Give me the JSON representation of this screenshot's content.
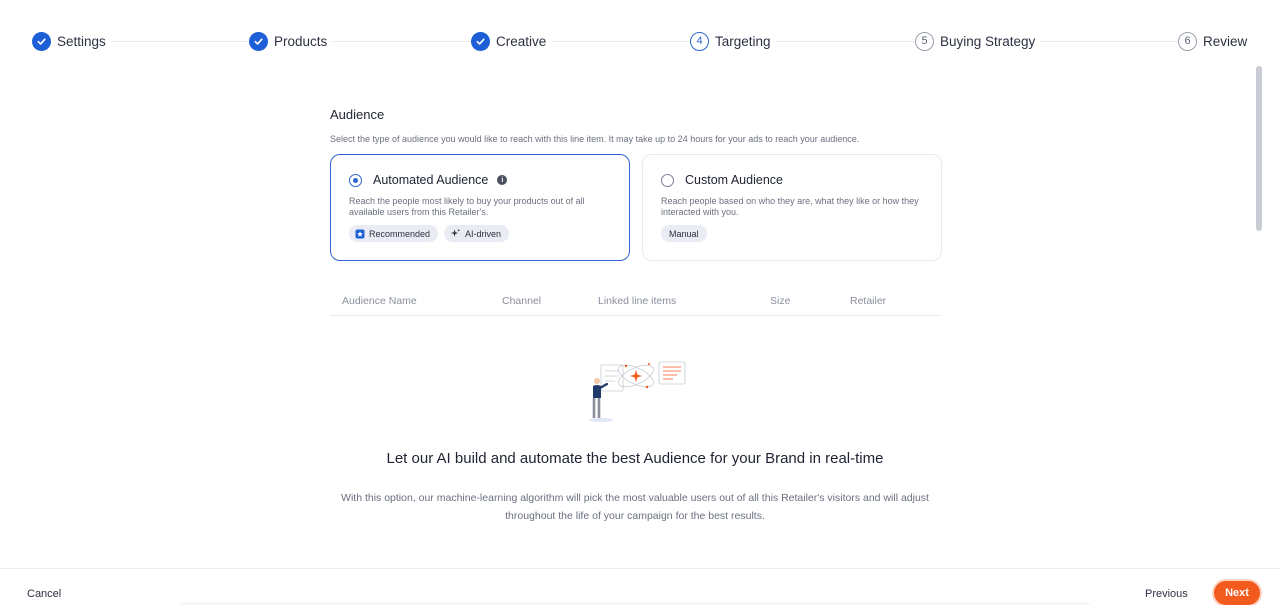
{
  "stepper": {
    "steps": [
      {
        "label": "Settings",
        "status": "done"
      },
      {
        "label": "Products",
        "status": "done"
      },
      {
        "label": "Creative",
        "status": "done"
      },
      {
        "label": "Targeting",
        "number": "4",
        "status": "current"
      },
      {
        "label": "Buying Strategy",
        "number": "5",
        "status": "todo"
      },
      {
        "label": "Review",
        "number": "6",
        "status": "todo"
      }
    ]
  },
  "audience": {
    "title": "Audience",
    "description": "Select the type of audience you would like to reach with this line item. It may take up to 24 hours for your ads to reach your audience.",
    "options": [
      {
        "title": "Automated Audience",
        "description": "Reach the people most likely to buy your products out of all available users from this Retailer's.",
        "selected": true,
        "chips": [
          "Recommended",
          "AI-driven"
        ]
      },
      {
        "title": "Custom Audience",
        "description": "Reach people based on who they are, what they like or how they interacted with you.",
        "selected": false,
        "chips": [
          "Manual"
        ]
      }
    ]
  },
  "table": {
    "columns": [
      "Audience Name",
      "Channel",
      "Linked line items",
      "Size",
      "Retailer"
    ]
  },
  "empty_state": {
    "title": "Let our AI build and automate the best Audience for your Brand in real-time",
    "description": "With this option, our machine-learning algorithm will pick the most valuable users out of all this Retailer's visitors and will adjust throughout the life of your campaign for the best results."
  },
  "footer": {
    "cancel_label": "Cancel",
    "previous_label": "Previous",
    "next_label": "Next"
  },
  "colors": {
    "primary": "#1d5fd6",
    "accent": "#f25a1e"
  }
}
